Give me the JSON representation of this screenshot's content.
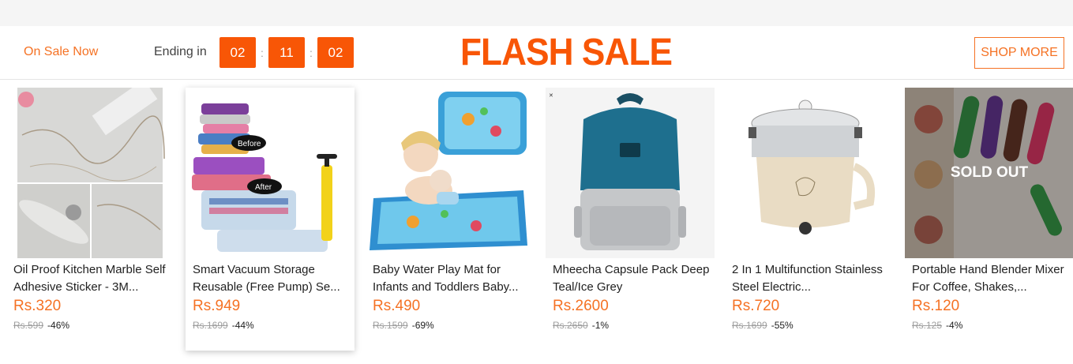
{
  "header": {
    "on_sale": "On Sale Now",
    "ending_label": "Ending in",
    "timer": {
      "hours": "02",
      "minutes": "11",
      "seconds": "02"
    },
    "title": "FLASH SALE",
    "shop_more": "SHOP MORE"
  },
  "colors": {
    "accent": "#f85606",
    "text_accent": "#f57224"
  },
  "products": [
    {
      "name": "Oil Proof Kitchen Marble Self Adhesive Sticker - 3M...",
      "price": "Rs.320",
      "original": "Rs.599",
      "discount": "-46%",
      "icon": "marble-sticker-image"
    },
    {
      "name": "Smart Vacuum Storage Reusable (Free Pump) Se...",
      "price": "Rs.949",
      "original": "Rs.1699",
      "discount": "-44%",
      "icon": "vacuum-storage-bag-image"
    },
    {
      "name": "Baby Water Play Mat for Infants and Toddlers Baby...",
      "price": "Rs.490",
      "original": "Rs.1599",
      "discount": "-69%",
      "icon": "baby-play-mat-image"
    },
    {
      "name": "Mheecha Capsule Pack Deep Teal/Ice Grey",
      "price": "Rs.2600",
      "original": "Rs.2650",
      "discount": "-1%",
      "icon": "backpack-image"
    },
    {
      "name": "2 In 1 Multifunction Stainless Steel Electric...",
      "price": "Rs.720",
      "original": "Rs.1699",
      "discount": "-55%",
      "icon": "electric-cooker-image"
    },
    {
      "name": "Portable Hand Blender Mixer For Coffee, Shakes,...",
      "price": "Rs.120",
      "original": "Rs.125",
      "discount": "-4%",
      "icon": "hand-blender-image",
      "sold_out": "SOLD OUT"
    }
  ]
}
